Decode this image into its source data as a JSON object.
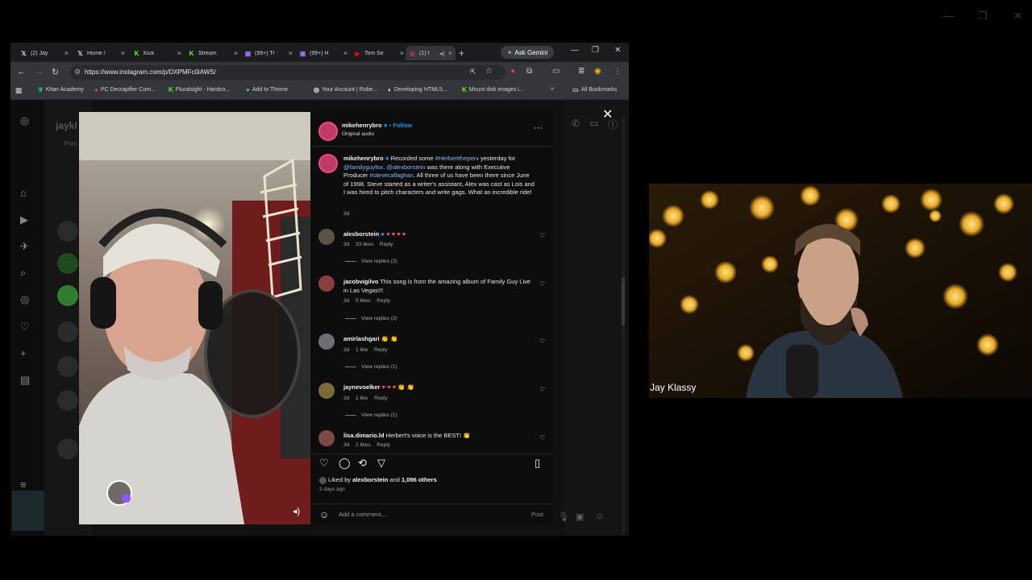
{
  "browser": {
    "tabs": [
      {
        "label": "(2) Jay",
        "icon": "x-icon"
      },
      {
        "label": "Home /",
        "icon": "x-icon"
      },
      {
        "label": "Kick",
        "icon": "kick-icon"
      },
      {
        "label": "Stream",
        "icon": "kick-icon"
      },
      {
        "label": "(99+) Tr",
        "icon": "twitch-icon"
      },
      {
        "label": "(99+) H",
        "icon": "twitch-icon"
      },
      {
        "label": "Tom Se",
        "icon": "youtube-icon"
      },
      {
        "label": "(1) I",
        "icon": "instagram-icon",
        "active": true
      }
    ],
    "ask_gemini": "Ask Gemini",
    "url": "https://www.instagram.com/p/DXPMFc0iAWS/",
    "bookmarks": [
      "Khan Academy",
      "PC Decrapifier Com...",
      "Pluralsight - Hardco...",
      "Add to Throne",
      "Your Account | Robe...",
      "Developing HTML5...",
      "Mount disk images i..."
    ],
    "all_bookmarks": "All Bookmarks"
  },
  "page": {
    "bg_username": "jaykl",
    "bg_tab": "Prim"
  },
  "post": {
    "author": "mikehenrybro",
    "follow": "Follow",
    "audio": "Original audio",
    "caption_user": "mikehenrybro",
    "caption_parts": {
      "p1": "Recorded some ",
      "tag1": "#Herberttheperv",
      "p2": " yesterday for ",
      "tag2": "@familyguyfox",
      "p3": ". ",
      "tag3": "@alexborstein",
      "p4": " was there along with Executive Producer ",
      "tag4": "#stevecallaghan",
      "p5": ". All three of us have been there since June of 1998. Steve started as a writer's assistant, Alex was cast as Lois and I was hired to pitch characters and write gags. What an incredible ride!"
    },
    "caption_time": "3d",
    "comments": [
      {
        "user": "alexborstein",
        "text": "",
        "hearts": "♥ ♥ ♥ ♥",
        "time": "3d",
        "likes": "33 likes",
        "reply": "Reply",
        "view_replies": "View replies (3)"
      },
      {
        "user": "jacobvigilvo",
        "text": "This song is from the amazing album of Family Guy Live in Las Vegas!!!",
        "time": "3d",
        "likes": "5 likes",
        "reply": "Reply",
        "view_replies": "View replies (3)"
      },
      {
        "user": "amirlashgari",
        "text": "👏 👏",
        "time": "3d",
        "likes": "1 like",
        "reply": "Reply",
        "view_replies": "View replies (1)"
      },
      {
        "user": "jaynevoelker",
        "text": "👏 👏",
        "hearts": "♥ ♥ ♥",
        "time": "3d",
        "likes": "1 like",
        "reply": "Reply",
        "view_replies": "View replies (1)"
      },
      {
        "user": "lisa.dimario.ld",
        "text": "Herbert's voice is the BEST! 👏",
        "time": "3d",
        "likes": "2 likes",
        "reply": "Reply"
      }
    ],
    "liked_prefix": "Liked by ",
    "liked_user": "alexborstein",
    "liked_and": " and ",
    "liked_others": "1,096 others",
    "ago": "3 days ago",
    "add_comment": "Add a comment...",
    "post_label": "Post"
  },
  "webcam": {
    "name": "Jay Klassy"
  },
  "colors": {
    "accent_blue": "#0095f6",
    "panel_bg": "#0d0d0d",
    "heart_red": "#ff4d6d"
  }
}
